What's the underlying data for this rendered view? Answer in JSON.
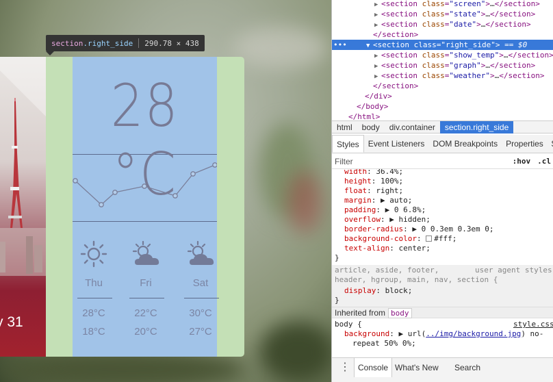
{
  "page": {
    "tooltip": {
      "tag": "section",
      "class": ".right_side",
      "size": "290.78 × 438"
    },
    "app": {
      "date_text": "y 31",
      "temperature": "28 °C",
      "graph_points": [
        52,
        17,
        35,
        44,
        30,
        62,
        75
      ],
      "forecast": [
        {
          "day": "Thu",
          "icon": "sun-icon",
          "high": "28°C",
          "low": "18°C"
        },
        {
          "day": "Fri",
          "icon": "partly-cloudy-icon",
          "high": "22°C",
          "low": "20°C"
        },
        {
          "day": "Sat",
          "icon": "partly-cloudy-icon",
          "high": "30°C",
          "low": "27°C"
        }
      ]
    }
  },
  "devtools": {
    "dom": [
      {
        "indent": 4,
        "tri": "▶",
        "tag": "section",
        "cls": "screen",
        "collapsed": true
      },
      {
        "indent": 4,
        "tri": "▶",
        "tag": "section",
        "cls": "state",
        "collapsed": true
      },
      {
        "indent": 4,
        "tri": "▶",
        "tag": "section",
        "cls": "date",
        "collapsed": true
      },
      {
        "indent": 3,
        "tri": "",
        "close": "</section>"
      },
      {
        "indent": 3,
        "tri": "▼",
        "tag": "section",
        "cls": "right_side",
        "selected": true,
        "suffix": " == $0"
      },
      {
        "indent": 4,
        "tri": "▶",
        "tag": "section",
        "cls": "show_temp",
        "collapsed": true
      },
      {
        "indent": 4,
        "tri": "▶",
        "tag": "section",
        "cls": "graph",
        "collapsed": true
      },
      {
        "indent": 4,
        "tri": "▶",
        "tag": "section",
        "cls": "weather",
        "collapsed": true
      },
      {
        "indent": 3,
        "tri": "",
        "close": "</section>"
      },
      {
        "indent": 2,
        "tri": "",
        "close": "</div>"
      },
      {
        "indent": 1,
        "tri": "",
        "close": "</body>"
      },
      {
        "indent": 0,
        "tri": "",
        "close": "</html>"
      }
    ],
    "breadcrumbs": [
      "html",
      "body",
      "div.container",
      "section.right_side"
    ],
    "tabs": [
      "Styles",
      "Event Listeners",
      "DOM Breakpoints",
      "Properties",
      "$sc"
    ],
    "filter_placeholder": "Filter",
    "hov": ":hov",
    "cls": ".cl",
    "style_rules": [
      {
        "p": "width",
        "v": "36.4%;"
      },
      {
        "p": "height",
        "v": "100%;"
      },
      {
        "p": "float",
        "v": "right;"
      },
      {
        "p": "margin",
        "v": "▶ auto;"
      },
      {
        "p": "padding",
        "v": "▶ 0 6.8%;"
      },
      {
        "p": "overflow",
        "v": "▶ hidden;"
      },
      {
        "p": "border-radius",
        "v": "▶ 0 0.3em 0.3em 0;"
      },
      {
        "p": "background-color",
        "v": "#fff;",
        "swatch": "#ffffff"
      },
      {
        "p": "text-align",
        "v": "center;"
      }
    ],
    "close_brace": "}",
    "ua_selector_1": "article, aside, footer,",
    "ua_label": "user agent styles",
    "ua_selector_2": "header, hgroup, main, nav, section {",
    "ua_prop": "display",
    "ua_val": "block;",
    "inherited_label": "Inherited from",
    "inherited_from": "body",
    "body_selector": "body {",
    "body_file": "style.css",
    "body_prop": "background",
    "body_val_prefix": "▶ url(",
    "body_url": "../img/background.jpg",
    "body_val_suffix": ") no-",
    "body_val_line2": "repeat 50% 0%;",
    "console_tabs": [
      "Console",
      "What's New",
      "Search"
    ]
  }
}
